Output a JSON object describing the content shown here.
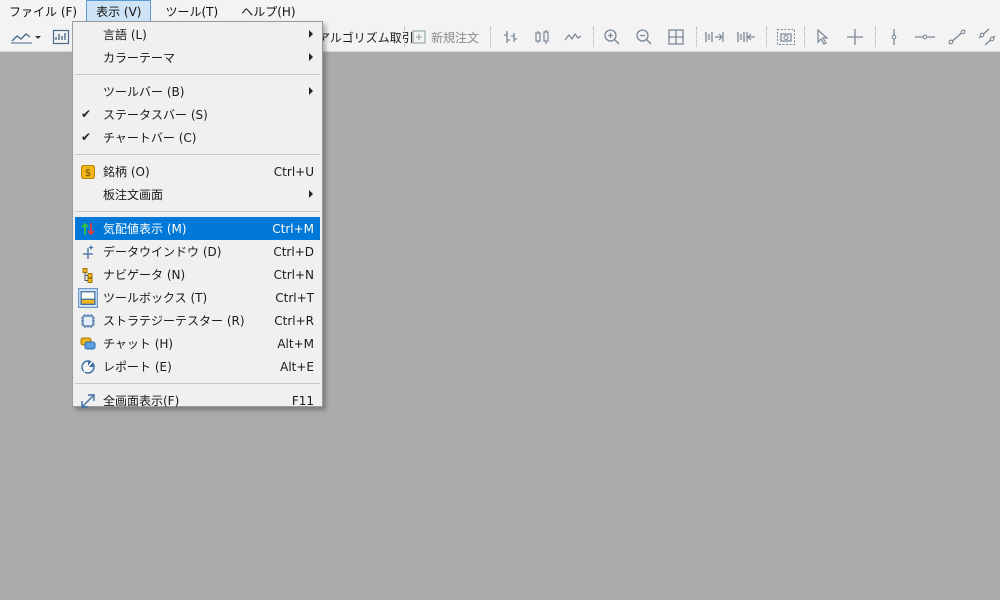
{
  "menubar": {
    "items": [
      {
        "label": "ファイル (F)"
      },
      {
        "label": "表示 (V)"
      },
      {
        "label": "ツール(T)"
      },
      {
        "label": "ヘルプ(H)"
      }
    ]
  },
  "toolbar": {
    "algo_label": "アルゴリズム取引",
    "new_order_label": "新規注文"
  },
  "view_menu": {
    "language": {
      "label": "言語 (L)"
    },
    "color_theme": {
      "label": "カラーテーマ"
    },
    "toolbars": {
      "label": "ツールバー (B)"
    },
    "status_bar": {
      "label": "ステータスバー (S)",
      "checked": true
    },
    "chart_bar": {
      "label": "チャートバー (C)",
      "checked": true
    },
    "symbols": {
      "label": "銘柄 (O)",
      "shortcut": "Ctrl+U"
    },
    "depth_of_market": {
      "label": "板注文画面"
    },
    "market_watch": {
      "label": "気配値表示 (M)",
      "shortcut": "Ctrl+M"
    },
    "data_window": {
      "label": "データウインドウ (D)",
      "shortcut": "Ctrl+D"
    },
    "navigator": {
      "label": "ナビゲータ (N)",
      "shortcut": "Ctrl+N"
    },
    "toolbox": {
      "label": "ツールボックス (T)",
      "shortcut": "Ctrl+T"
    },
    "strategy_tester": {
      "label": "ストラテジーテスター (R)",
      "shortcut": "Ctrl+R"
    },
    "chat": {
      "label": "チャット (H)",
      "shortcut": "Alt+M"
    },
    "report": {
      "label": "レポート (E)",
      "shortcut": "Alt+E"
    },
    "full_screen": {
      "label": "全画面表示(F)",
      "shortcut": "F11"
    }
  },
  "colors": {
    "highlight": "#0078d7",
    "background": "#ababab",
    "menu_bg": "#f0f0f0"
  }
}
